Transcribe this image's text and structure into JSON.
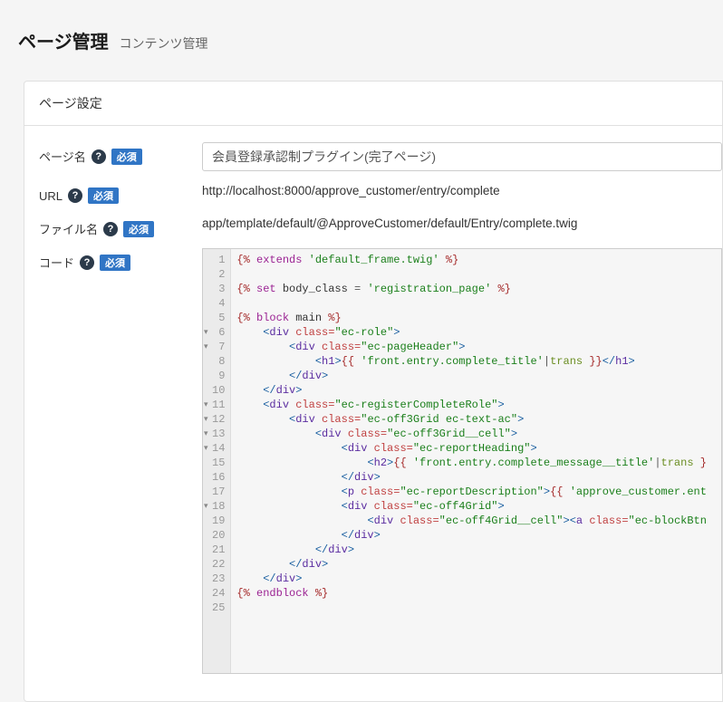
{
  "header": {
    "title": "ページ管理",
    "subtitle": "コンテンツ管理"
  },
  "panel": {
    "title": "ページ設定"
  },
  "labels": {
    "page_name": "ページ名",
    "url": "URL",
    "file_name": "ファイル名",
    "code": "コード",
    "required_badge": "必須"
  },
  "values": {
    "page_name": "会員登録承認制プラグイン(完了ページ)",
    "url": "http://localhost:8000/approve_customer/entry/complete",
    "file_name": "app/template/default/@ApproveCustomer/default/Entry/complete.twig"
  },
  "code_lines": [
    {
      "n": 1,
      "fold": false,
      "t": [
        [
          "{% ",
          "tag-d"
        ],
        [
          "extends",
          "kw"
        ],
        [
          " ",
          ""
        ],
        [
          "'default_frame.twig'",
          "str"
        ],
        [
          " %}",
          "tag-d"
        ]
      ]
    },
    {
      "n": 2,
      "fold": false,
      "t": []
    },
    {
      "n": 3,
      "fold": false,
      "t": [
        [
          "{% ",
          "tag-d"
        ],
        [
          "set",
          "kw"
        ],
        [
          " body_class ",
          ""
        ],
        [
          "=",
          "op"
        ],
        [
          " ",
          ""
        ],
        [
          "'registration_page'",
          "str"
        ],
        [
          " %}",
          "tag-d"
        ]
      ]
    },
    {
      "n": 4,
      "fold": false,
      "t": []
    },
    {
      "n": 5,
      "fold": false,
      "t": [
        [
          "{% ",
          "tag-d"
        ],
        [
          "block",
          "kw"
        ],
        [
          " main ",
          ""
        ],
        [
          "%}",
          "tag-d"
        ]
      ]
    },
    {
      "n": 6,
      "fold": true,
      "t": [
        [
          "    ",
          ""
        ],
        [
          "<",
          "html"
        ],
        [
          "div",
          "tagn"
        ],
        [
          " ",
          ""
        ],
        [
          "class=",
          "attr"
        ],
        [
          "\"ec-role\"",
          "val"
        ],
        [
          ">",
          "html"
        ]
      ]
    },
    {
      "n": 7,
      "fold": true,
      "t": [
        [
          "        ",
          ""
        ],
        [
          "<",
          "html"
        ],
        [
          "div",
          "tagn"
        ],
        [
          " ",
          ""
        ],
        [
          "class=",
          "attr"
        ],
        [
          "\"ec-pageHeader\"",
          "val"
        ],
        [
          ">",
          "html"
        ]
      ]
    },
    {
      "n": 8,
      "fold": false,
      "t": [
        [
          "            ",
          ""
        ],
        [
          "<",
          "html"
        ],
        [
          "h1",
          "tagn"
        ],
        [
          ">",
          "html"
        ],
        [
          "{{ ",
          "out"
        ],
        [
          "'front.entry.complete_title'",
          "str"
        ],
        [
          "|",
          "op"
        ],
        [
          "trans ",
          "filter"
        ],
        [
          "}}",
          "out"
        ],
        [
          "</",
          "html"
        ],
        [
          "h1",
          "tagn"
        ],
        [
          ">",
          "html"
        ]
      ]
    },
    {
      "n": 9,
      "fold": false,
      "t": [
        [
          "        ",
          ""
        ],
        [
          "</",
          "html"
        ],
        [
          "div",
          "tagn"
        ],
        [
          ">",
          "html"
        ]
      ]
    },
    {
      "n": 10,
      "fold": false,
      "t": [
        [
          "    ",
          ""
        ],
        [
          "</",
          "html"
        ],
        [
          "div",
          "tagn"
        ],
        [
          ">",
          "html"
        ]
      ]
    },
    {
      "n": 11,
      "fold": true,
      "t": [
        [
          "    ",
          ""
        ],
        [
          "<",
          "html"
        ],
        [
          "div",
          "tagn"
        ],
        [
          " ",
          ""
        ],
        [
          "class=",
          "attr"
        ],
        [
          "\"ec-registerCompleteRole\"",
          "val"
        ],
        [
          ">",
          "html"
        ]
      ]
    },
    {
      "n": 12,
      "fold": true,
      "t": [
        [
          "        ",
          ""
        ],
        [
          "<",
          "html"
        ],
        [
          "div",
          "tagn"
        ],
        [
          " ",
          ""
        ],
        [
          "class=",
          "attr"
        ],
        [
          "\"ec-off3Grid ec-text-ac\"",
          "val"
        ],
        [
          ">",
          "html"
        ]
      ]
    },
    {
      "n": 13,
      "fold": true,
      "t": [
        [
          "            ",
          ""
        ],
        [
          "<",
          "html"
        ],
        [
          "div",
          "tagn"
        ],
        [
          " ",
          ""
        ],
        [
          "class=",
          "attr"
        ],
        [
          "\"ec-off3Grid__cell\"",
          "val"
        ],
        [
          ">",
          "html"
        ]
      ]
    },
    {
      "n": 14,
      "fold": true,
      "t": [
        [
          "                ",
          ""
        ],
        [
          "<",
          "html"
        ],
        [
          "div",
          "tagn"
        ],
        [
          " ",
          ""
        ],
        [
          "class=",
          "attr"
        ],
        [
          "\"ec-reportHeading\"",
          "val"
        ],
        [
          ">",
          "html"
        ]
      ]
    },
    {
      "n": 15,
      "fold": false,
      "t": [
        [
          "                    ",
          ""
        ],
        [
          "<",
          "html"
        ],
        [
          "h2",
          "tagn"
        ],
        [
          ">",
          "html"
        ],
        [
          "{{ ",
          "out"
        ],
        [
          "'front.entry.complete_message__title'",
          "str"
        ],
        [
          "|",
          "op"
        ],
        [
          "trans ",
          "filter"
        ],
        [
          "}",
          "out"
        ]
      ]
    },
    {
      "n": 16,
      "fold": false,
      "t": [
        [
          "                ",
          ""
        ],
        [
          "</",
          "html"
        ],
        [
          "div",
          "tagn"
        ],
        [
          ">",
          "html"
        ]
      ]
    },
    {
      "n": 17,
      "fold": false,
      "t": [
        [
          "                ",
          ""
        ],
        [
          "<",
          "html"
        ],
        [
          "p",
          "tagn"
        ],
        [
          " ",
          ""
        ],
        [
          "class=",
          "attr"
        ],
        [
          "\"ec-reportDescription\"",
          "val"
        ],
        [
          ">",
          "html"
        ],
        [
          "{{ ",
          "out"
        ],
        [
          "'approve_customer.ent",
          "str"
        ]
      ]
    },
    {
      "n": 18,
      "fold": true,
      "t": [
        [
          "                ",
          ""
        ],
        [
          "<",
          "html"
        ],
        [
          "div",
          "tagn"
        ],
        [
          " ",
          ""
        ],
        [
          "class=",
          "attr"
        ],
        [
          "\"ec-off4Grid\"",
          "val"
        ],
        [
          ">",
          "html"
        ]
      ]
    },
    {
      "n": 19,
      "fold": false,
      "t": [
        [
          "                    ",
          ""
        ],
        [
          "<",
          "html"
        ],
        [
          "div",
          "tagn"
        ],
        [
          " ",
          ""
        ],
        [
          "class=",
          "attr"
        ],
        [
          "\"ec-off4Grid__cell\"",
          "val"
        ],
        [
          ">",
          "html"
        ],
        [
          "<",
          "html"
        ],
        [
          "a",
          "tagn"
        ],
        [
          " ",
          ""
        ],
        [
          "class=",
          "attr"
        ],
        [
          "\"ec-blockBtn",
          "val"
        ]
      ]
    },
    {
      "n": 20,
      "fold": false,
      "t": [
        [
          "                ",
          ""
        ],
        [
          "</",
          "html"
        ],
        [
          "div",
          "tagn"
        ],
        [
          ">",
          "html"
        ]
      ]
    },
    {
      "n": 21,
      "fold": false,
      "t": [
        [
          "            ",
          ""
        ],
        [
          "</",
          "html"
        ],
        [
          "div",
          "tagn"
        ],
        [
          ">",
          "html"
        ]
      ]
    },
    {
      "n": 22,
      "fold": false,
      "t": [
        [
          "        ",
          ""
        ],
        [
          "</",
          "html"
        ],
        [
          "div",
          "tagn"
        ],
        [
          ">",
          "html"
        ]
      ]
    },
    {
      "n": 23,
      "fold": false,
      "t": [
        [
          "    ",
          ""
        ],
        [
          "</",
          "html"
        ],
        [
          "div",
          "tagn"
        ],
        [
          ">",
          "html"
        ]
      ]
    },
    {
      "n": 24,
      "fold": false,
      "t": [
        [
          "{% ",
          "tag-d"
        ],
        [
          "endblock",
          "kw"
        ],
        [
          " %}",
          "tag-d"
        ]
      ]
    },
    {
      "n": 25,
      "fold": false,
      "t": []
    }
  ]
}
